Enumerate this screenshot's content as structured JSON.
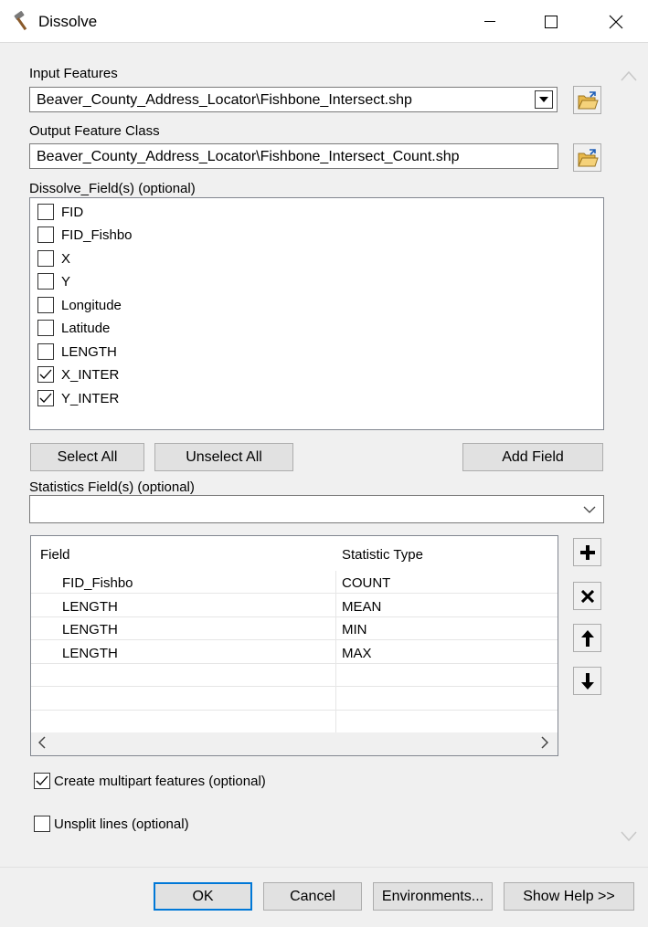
{
  "window": {
    "title": "Dissolve"
  },
  "input_features": {
    "label": "Input Features",
    "value": "Beaver_County_Address_Locator\\Fishbone_Intersect.shp"
  },
  "output_feature_class": {
    "label": "Output Feature Class",
    "value": "Beaver_County_Address_Locator\\Fishbone_Intersect_Count.shp"
  },
  "dissolve_fields": {
    "label": "Dissolve_Field(s) (optional)",
    "items": [
      {
        "label": "FID",
        "checked": false
      },
      {
        "label": "FID_Fishbo",
        "checked": false
      },
      {
        "label": "X",
        "checked": false
      },
      {
        "label": "Y",
        "checked": false
      },
      {
        "label": "Longitude",
        "checked": false
      },
      {
        "label": "Latitude",
        "checked": false
      },
      {
        "label": "LENGTH",
        "checked": false
      },
      {
        "label": "X_INTER",
        "checked": true
      },
      {
        "label": "Y_INTER",
        "checked": true
      }
    ]
  },
  "buttons": {
    "select_all": "Select All",
    "unselect_all": "Unselect All",
    "add_field": "Add Field"
  },
  "statistics_fields": {
    "label": "Statistics Field(s) (optional)",
    "selected": "",
    "columns": [
      "Field",
      "Statistic Type"
    ],
    "rows": [
      {
        "field": "FID_Fishbo",
        "type": "COUNT"
      },
      {
        "field": "LENGTH",
        "type": "MEAN"
      },
      {
        "field": "LENGTH",
        "type": "MIN"
      },
      {
        "field": "LENGTH",
        "type": "MAX"
      }
    ]
  },
  "options": {
    "multipart": {
      "label": "Create multipart features (optional)",
      "checked": true
    },
    "unsplit": {
      "label": "Unsplit lines (optional)",
      "checked": false
    }
  },
  "footer": {
    "ok": "OK",
    "cancel": "Cancel",
    "environments": "Environments...",
    "show_help": "Show Help >>"
  },
  "icons": {
    "app": "hammer-icon",
    "folder": "folder-open-icon",
    "add": "plus-icon",
    "remove": "delete-x-icon",
    "up": "arrow-up-icon",
    "down": "arrow-down-icon"
  }
}
